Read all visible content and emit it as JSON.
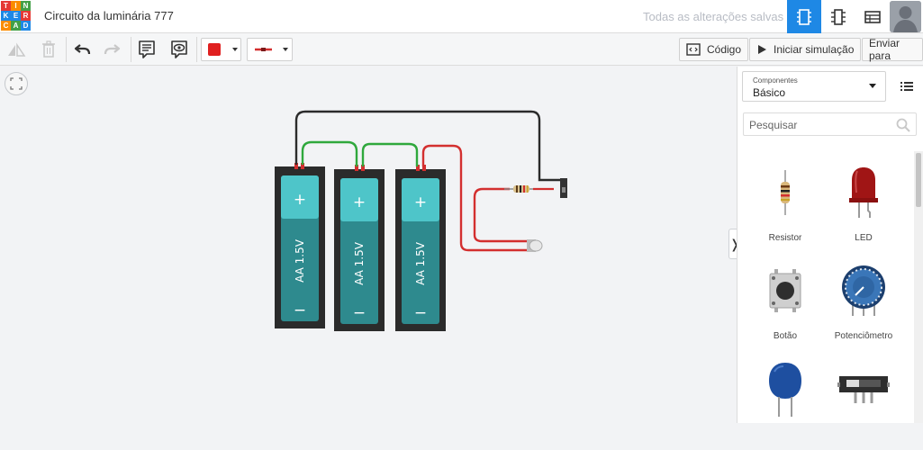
{
  "app": {
    "logo_letters": [
      "T",
      "I",
      "N",
      "K",
      "E",
      "R",
      "C",
      "A",
      "D"
    ],
    "logo_colors": [
      "#e53935",
      "#fb8c00",
      "#43a047",
      "#1e88e5",
      "#1e88e5",
      "#e53935",
      "#fb8c00",
      "#43a047",
      "#1e88e5"
    ],
    "title": "Circuito da luminária 777",
    "save_status": "Todas as alterações salvas",
    "accent": "#1e88e5"
  },
  "toolbar": {
    "code_label": "Código",
    "simulate_label": "Iniciar simulação",
    "send_label": "Enviar para",
    "fill_color": "#e02020",
    "wire_color": "#d32f2f"
  },
  "canvas": {
    "batteries": [
      {
        "plus": "+",
        "minus": "−",
        "label": "AA 1.5V"
      },
      {
        "plus": "+",
        "minus": "−",
        "label": "AA 1.5V"
      },
      {
        "plus": "+",
        "minus": "−",
        "label": "AA 1.5V"
      }
    ],
    "wire_colors": {
      "black": "#2b2b2b",
      "green": "#2fa83c",
      "red": "#d32f2f"
    }
  },
  "panel": {
    "category_caption": "Componentes",
    "category_value": "Básico",
    "search_placeholder": "Pesquisar",
    "components": [
      {
        "name": "Resistor",
        "icon": "resistor-icon"
      },
      {
        "name": "LED",
        "icon": "led-icon"
      },
      {
        "name": "Botão",
        "icon": "pushbutton-icon"
      },
      {
        "name": "Potenciômetro",
        "icon": "potentiometer-icon"
      },
      {
        "name": "",
        "icon": "capacitor-icon"
      },
      {
        "name": "",
        "icon": "slide-switch-icon"
      }
    ]
  }
}
